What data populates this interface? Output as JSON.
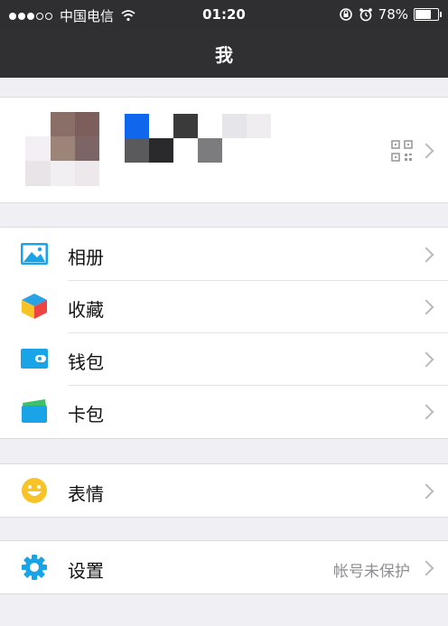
{
  "status_bar": {
    "carrier": "中国电信",
    "time": "01:20",
    "battery": "78%",
    "battery_level": 0.78
  },
  "nav": {
    "title": "我"
  },
  "menu": {
    "album": "相册",
    "favorites": "收藏",
    "wallet": "钱包",
    "card_pack": "卡包",
    "stickers": "表情",
    "settings": "设置",
    "settings_hint": "帐号未保护"
  },
  "colors": {
    "nav_bg": "#303033",
    "accent_blue": "#1aa4e8",
    "sticker_yellow": "#f7c326"
  },
  "icons": {
    "album": "image-icon",
    "favorites": "cube-icon",
    "wallet": "wallet-icon",
    "card_pack": "card-icon",
    "stickers": "smiley-icon",
    "settings": "gear-icon",
    "profile": "qr-code-icon"
  }
}
